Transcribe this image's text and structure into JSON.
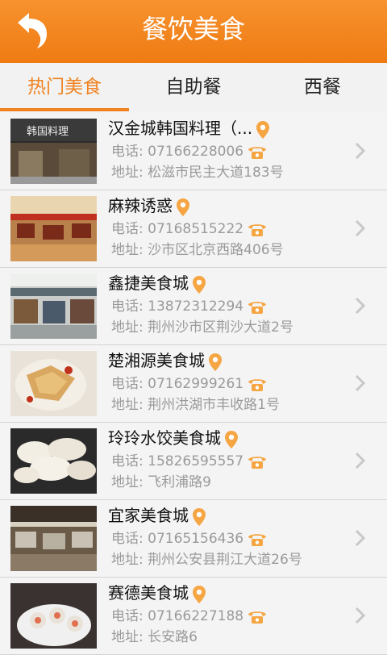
{
  "header": {
    "title": "餐饮美食",
    "back_icon": "back-arrow-icon"
  },
  "tabs": [
    {
      "label": "热门美食",
      "active": true
    },
    {
      "label": "自助餐",
      "active": false
    },
    {
      "label": "西餐",
      "active": false
    }
  ],
  "restaurants": [
    {
      "name": "汉金城韩国料理（...",
      "phone": "电话: 07166228006",
      "address": "地址: 松滋市民主大道183号",
      "thumb_sign": "韩国料理"
    },
    {
      "name": "麻辣诱惑",
      "phone": "电话: 07168515222",
      "address": "地址: 沙市区北京西路406号"
    },
    {
      "name": "鑫捷美食城",
      "phone": "电话: 13872312294",
      "address": "地址: 荆州沙市区荆沙大道2号"
    },
    {
      "name": "楚湘源美食城",
      "phone": "电话: 07162999261",
      "address": "地址: 荆州洪湖市丰收路1号"
    },
    {
      "name": "玲玲水饺美食城",
      "phone": "电话: 15826595557",
      "address": "地址: 飞利浦路9"
    },
    {
      "name": "宜家美食城",
      "phone": "电话: 07165156436",
      "address": "地址: 荆州公安县荆江大道26号"
    },
    {
      "name": "赛德美食城",
      "phone": "电话: 07166227188",
      "address": "地址: 长安路6"
    }
  ],
  "colors": {
    "accent": "#f0821f",
    "header": "#f28a24"
  }
}
